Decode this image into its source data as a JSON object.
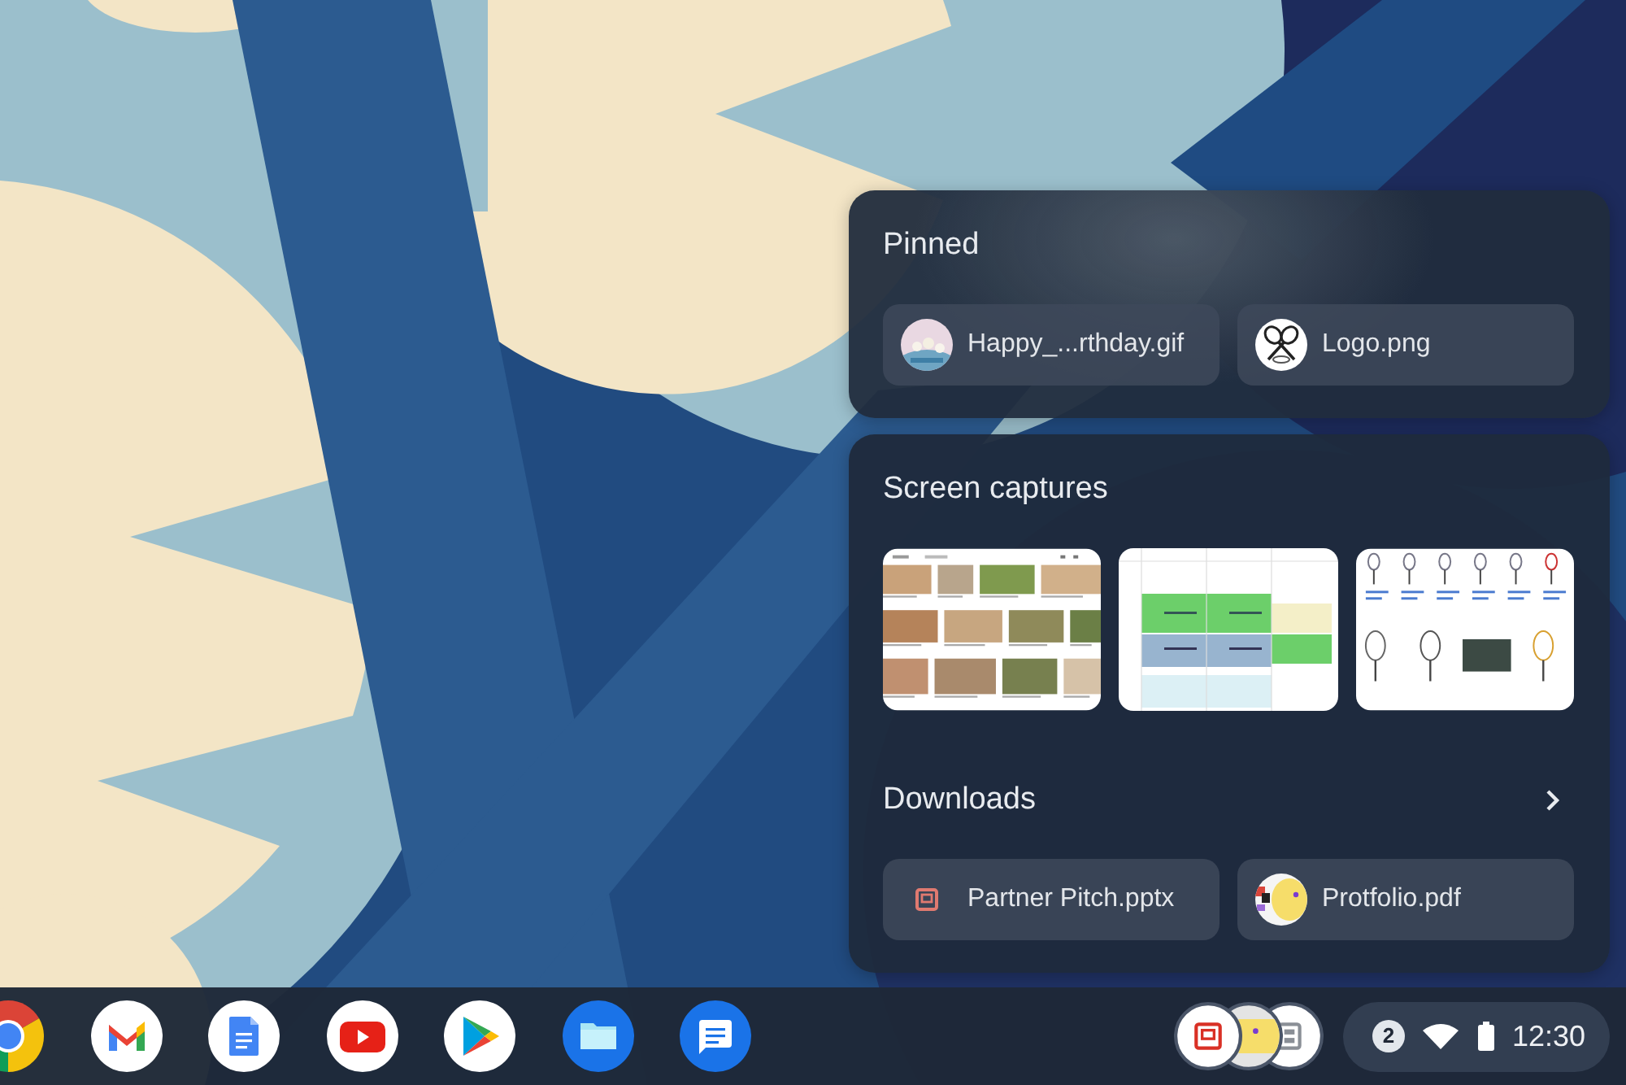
{
  "holding_space": {
    "pinned": {
      "title": "Pinned",
      "items": [
        {
          "label": "Happy_...rthday.gif",
          "kind": "photo"
        },
        {
          "label": "Logo.png",
          "kind": "logo"
        }
      ]
    },
    "screen_captures": {
      "title": "Screen captures",
      "items": [
        {
          "kind": "photo-grid"
        },
        {
          "kind": "schedule"
        },
        {
          "kind": "product-grid"
        }
      ]
    },
    "downloads": {
      "title": "Downloads",
      "items": [
        {
          "label": "Partner Pitch.pptx",
          "kind": "slides"
        },
        {
          "label": "Protfolio.pdf",
          "kind": "pdf"
        }
      ]
    }
  },
  "shelf": {
    "tray": {
      "items": [
        {
          "kind": "slides"
        },
        {
          "kind": "pdf"
        },
        {
          "kind": "document"
        }
      ]
    },
    "status": {
      "notification_count": "2",
      "time": "12:30"
    }
  }
}
